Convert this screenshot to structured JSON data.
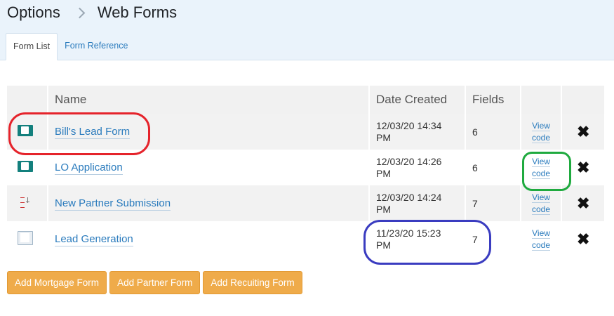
{
  "header": {
    "breadcrumb": [
      "Options",
      "Web Forms"
    ],
    "tabs": [
      {
        "label": "Form List",
        "active": true
      },
      {
        "label": "Form Reference",
        "active": false
      }
    ]
  },
  "table": {
    "columns": [
      "",
      "Name",
      "Date Created",
      "Fields",
      "",
      ""
    ],
    "rows": [
      {
        "icon": "form-thumbnail-teal-icon",
        "name": "Bill's Lead Form",
        "date_line1": "12/03/20 14:34",
        "date_line2": "PM",
        "fields": "6",
        "view_line1": "View",
        "view_line2": "code"
      },
      {
        "icon": "form-thumbnail-teal-icon",
        "name": "LO Application",
        "date_line1": "12/03/20 14:26",
        "date_line2": "PM",
        "fields": "6",
        "view_line1": "View",
        "view_line2": "code"
      },
      {
        "icon": "form-thumbnail-sketch-icon",
        "name": "New Partner Submission",
        "date_line1": "12/03/20 14:24",
        "date_line2": "PM",
        "fields": "7",
        "view_line1": "View",
        "view_line2": "code"
      },
      {
        "icon": "form-thumbnail-document-icon",
        "name": "Lead Generation",
        "date_line1": "11/23/20 15:23",
        "date_line2": "PM",
        "fields": "7",
        "view_line1": "View",
        "view_line2": "code"
      }
    ],
    "delete_glyph": "✖"
  },
  "buttons": {
    "add_mortgage": "Add Mortgage Form",
    "add_partner": "Add Partner Form",
    "add_recruiting": "Add Recuiting Form"
  },
  "colors": {
    "accent_link": "#2a7bbd",
    "button": "#efab4a",
    "header_bg": "#eaf3fb",
    "annotation_red": "#e5232b",
    "annotation_green": "#1faa3f",
    "annotation_blue": "#3a3cc0"
  }
}
